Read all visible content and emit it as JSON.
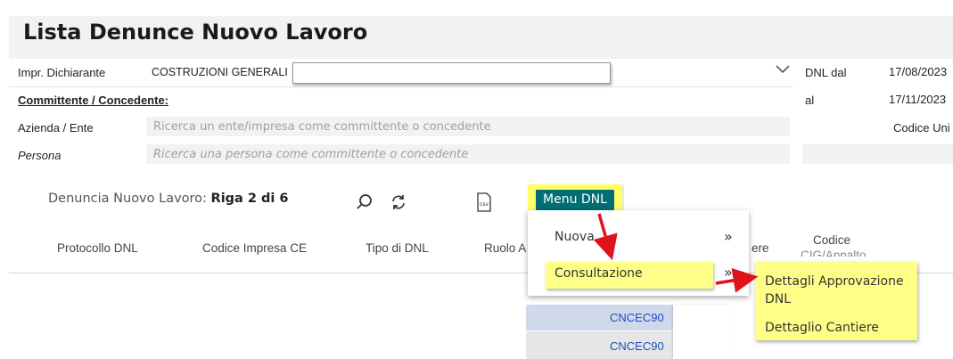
{
  "page": {
    "title": "Lista Denunce Nuovo Lavoro"
  },
  "filters": {
    "impr_label": "Impr. Dichiarante",
    "impr_value": "COSTRUZIONI GENERALI",
    "committente_label": "Committente / Concedente:",
    "azienda_label": "Azienda / Ente",
    "azienda_placeholder": "Ricerca un ente/impresa come committente o concedente",
    "persona_label": "Persona",
    "persona_placeholder": "Ricerca una persona come committente o concedente",
    "dnl_dal_label": "DNL dal",
    "dnl_dal_value": "17/08/2023",
    "al_label": "al",
    "al_value": "17/11/2023",
    "codice_label": "Codice Uni"
  },
  "toolbar": {
    "row_prefix": "Denuncia Nuovo Lavoro:",
    "row_info": "Riga 2 di 6",
    "menu_label": "Menu DNL",
    "csv_label": "csv"
  },
  "columns": [
    "Protocollo DNL",
    "Codice Impresa CE",
    "Tipo di DNL",
    "Ruolo A",
    "ere",
    "Codice",
    "CIG/Appalto"
  ],
  "menu": {
    "items": [
      "Nuova",
      "Consultazione"
    ],
    "submenu_marker": "»"
  },
  "submenu": {
    "item1_line1": "Dettagli Approvazione",
    "item1_line2": "DNL",
    "item2": "Dettaglio Cantiere"
  },
  "table": {
    "rows": [
      "CNCEC90",
      "CNCEC90"
    ]
  },
  "colors": {
    "menu_button": "#006e74",
    "highlight": "#ffff88",
    "arrow": "#e0121b",
    "link": "#1a4fc4"
  }
}
